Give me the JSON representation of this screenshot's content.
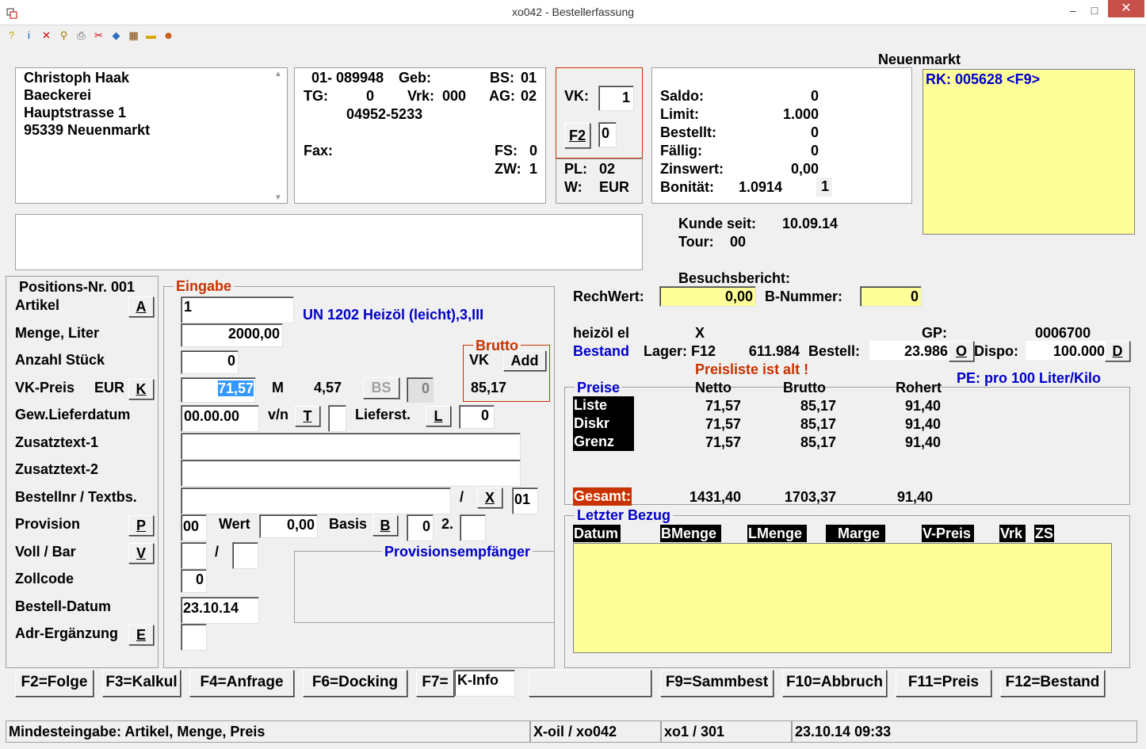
{
  "window": {
    "title": "xo042 - Bestellerfassung",
    "minimize": "–",
    "maximize": "□",
    "close": "✕"
  },
  "header": {
    "ort": "Neuenmarkt"
  },
  "address": {
    "line1": "Christoph Haak",
    "line2": "Baeckerei",
    "line3": "Hauptstrasse 1",
    "line4": "95339 Neuenmarkt"
  },
  "kunde": {
    "nr": "01- 089948",
    "geb_label": "Geb:",
    "bs_label": "BS:",
    "bs": "01",
    "tg_label": "TG:",
    "tg": "0",
    "vrk_label": "Vrk:",
    "vrk": "000",
    "ag_label": "AG:",
    "ag": "02",
    "phone": "04952-5233",
    "fax_label": "Fax:",
    "fs_label": "FS:",
    "fs": "0",
    "zw_label": "ZW:",
    "zw": "1"
  },
  "vk": {
    "label": "VK:",
    "value": "1",
    "f2": "F2",
    "f2_value": "0",
    "pl_label": "PL:",
    "pl": "02",
    "w_label": "W:",
    "w": "EUR"
  },
  "konto": {
    "saldo_label": "Saldo:",
    "saldo": "0",
    "limit_label": "Limit:",
    "limit": "1.000",
    "bestellt_label": "Bestellt:",
    "bestellt": "0",
    "faellig_label": "Fällig:",
    "faellig": "0",
    "zinswert_label": "Zinswert:",
    "zinswert": "0,00",
    "bonitaet_label": "Bonität:",
    "bonitaet": "1.0914",
    "bonitaet_flag": "1"
  },
  "rk": "RK: 005628 <F9>",
  "kunde_seit_label": "Kunde seit:",
  "kunde_seit": "10.09.14",
  "tour_label": "Tour:",
  "tour": "00",
  "besuchsbericht": "Besuchsbericht:",
  "rechwert_label": "RechWert:",
  "rechwert": "0,00",
  "bnummer_label": "B-Nummer:",
  "bnummer": "0",
  "position": {
    "label": "Positions-Nr. 001",
    "eingabe": "Eingabe"
  },
  "labels": {
    "artikel": "Artikel",
    "menge": "Menge, Liter",
    "anzahl": "Anzahl Stück",
    "vkpreis": "VK-Preis",
    "gewlief": "Gew.Lieferdatum",
    "zusatz1": "Zusatztext-1",
    "zusatz2": "Zusatztext-2",
    "bestellnr": "Bestellnr / Textbs.",
    "provision": "Provision",
    "vollbar": "Voll / Bar",
    "zollcode": "Zollcode",
    "bestelldatum": "Bestell-Datum",
    "adrerg": "Adr-Ergänzung"
  },
  "keys": {
    "a": "A",
    "k": "K",
    "t": "T",
    "l": "L",
    "x": "X",
    "p": "P",
    "b": "B",
    "v": "V",
    "e": "E",
    "o": "O",
    "d": "D"
  },
  "form": {
    "artikel": "1",
    "artikel_desc": "UN 1202 Heizöl (leicht),3,III",
    "menge": "2000,00",
    "anzahl": "0",
    "eur": "EUR",
    "vkpreis": "71,57",
    "m_label": "M",
    "m_value": "4,57",
    "bs_btn": "BS",
    "bs_val": "0",
    "brutto_label": "Brutto",
    "brutto_vk": "VK",
    "add_btn": "Add",
    "brutto_value": "85,17",
    "gewlief": "00.00.00",
    "vn_label": "v/n",
    "lieferst_label": "Lieferst.",
    "lieferst": "0",
    "slash": "/",
    "bestellnr_right": "01",
    "provision": "00",
    "wert_label": "Wert",
    "wert": "0,00",
    "basis_label": "Basis",
    "basis": "0",
    "zweite_label": "2.",
    "vollbar_slash": "/",
    "provempf_label": "Provisionsempfänger",
    "zollcode": "0",
    "bestelldatum": "23.10.14"
  },
  "artikelinfo": {
    "name": "heizöl el",
    "x": "X",
    "gp_label": "GP:",
    "gp": "0006700",
    "bestand": "Bestand",
    "lager_label": "Lager: F12",
    "lager": "611.984",
    "bestell_label": "Bestell:",
    "bestell": "23.986",
    "dispo_label": "Dispo:",
    "dispo": "100.000",
    "preisliste_alt": "Preisliste ist alt !",
    "pe": "PE:  pro 100 Liter/Kilo"
  },
  "preise": {
    "title": "Preise",
    "headers": [
      "Netto",
      "Brutto",
      "Rohert"
    ],
    "rows": [
      {
        "name": "Liste",
        "netto": "71,57",
        "brutto": "85,17",
        "rohert": "91,40"
      },
      {
        "name": "Diskr",
        "netto": "71,57",
        "brutto": "85,17",
        "rohert": "91,40"
      },
      {
        "name": "Grenz",
        "netto": "71,57",
        "brutto": "85,17",
        "rohert": "91,40"
      }
    ],
    "gesamt_label": "Gesamt:",
    "gesamt_netto": "1431,40",
    "gesamt_brutto": "1703,37",
    "gesamt_rohert": "91,40"
  },
  "letzter_bezug": {
    "title": "Letzter Bezug",
    "cols": [
      "Datum",
      "BMenge",
      "LMenge",
      "Marge",
      "V-Preis",
      "Vrk",
      "ZS"
    ]
  },
  "fkeys": {
    "f2": "F2=Folge",
    "f3": "F3=Kalkul",
    "f4": "F4=Anfrage",
    "f6": "F6=Docking",
    "f7": "F7=",
    "f7_value": "K-Info",
    "f9": "F9=Sammbest",
    "f10": "F10=Abbruch",
    "f11": "F11=Preis",
    "f12": "F12=Bestand"
  },
  "statusbar": {
    "msg": "Mindesteingabe: Artikel, Menge, Preis",
    "app": "X-oil / xo042",
    "user": "xo1 / 301",
    "datetime": "23.10.14 09:33"
  }
}
